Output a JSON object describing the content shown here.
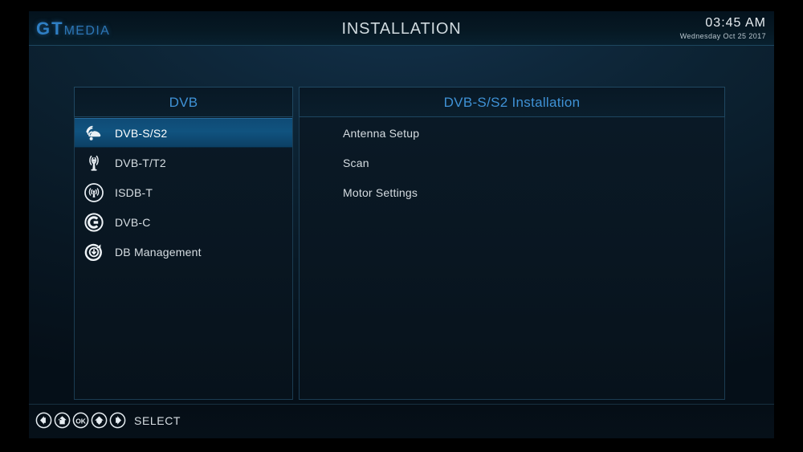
{
  "app": {
    "logo_gt": "GT",
    "logo_media": "MEDIA",
    "title": "INSTALLATION"
  },
  "clock": {
    "time": "03:45  AM",
    "date": "Wednesday  Oct 25 2017"
  },
  "sidebar": {
    "header": "DVB",
    "items": [
      {
        "label": "DVB-S/S2",
        "icon": "satellite-dish-icon",
        "selected": true
      },
      {
        "label": "DVB-T/T2",
        "icon": "antenna-tower-icon",
        "selected": false
      },
      {
        "label": "ISDB-T",
        "icon": "circled-broadcast-icon",
        "selected": false
      },
      {
        "label": "DVB-C",
        "icon": "circled-c-icon",
        "selected": false
      },
      {
        "label": "DB Management",
        "icon": "circular-refresh-icon",
        "selected": false
      }
    ]
  },
  "main": {
    "header": "DVB-S/S2 Installation",
    "items": [
      {
        "label": "Antenna Setup"
      },
      {
        "label": "Scan"
      },
      {
        "label": "Motor Settings"
      }
    ]
  },
  "footer": {
    "keys": [
      {
        "icon": "arrow-left-key-icon"
      },
      {
        "icon": "arrow-up-key-icon"
      },
      {
        "icon": "ok-key-icon"
      },
      {
        "icon": "arrow-down-key-icon"
      },
      {
        "icon": "arrow-right-key-icon"
      }
    ],
    "hint": "SELECT"
  },
  "colors": {
    "accent_blue": "#3f92d6",
    "logo_blue": "#2f7fc4",
    "selection_blue": "#10537f",
    "text_primary": "#d7dee3",
    "panel_bg": "#0a1a27",
    "panel_border": "#1b3c52"
  }
}
